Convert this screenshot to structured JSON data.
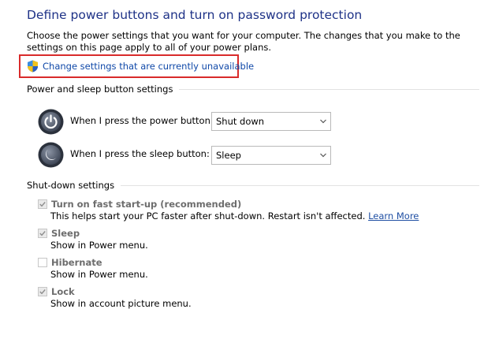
{
  "page": {
    "title": "Define power buttons and turn on password protection",
    "description": "Choose the power settings that you want for your computer. The changes that you make to the settings on this page apply to all of your power plans.",
    "change_settings_link": "Change settings that are currently unavailable",
    "highlight_color": "#d92b2b",
    "link_color": "#0f48a8",
    "title_color": "#1e3287"
  },
  "power_sleep": {
    "heading": "Power and sleep button settings",
    "power_button": {
      "label": "When I press the power button:",
      "value": "Shut down",
      "icon": "power-button-icon"
    },
    "sleep_button": {
      "label": "When I press the sleep button:",
      "value": "Sleep",
      "icon": "sleep-button-icon"
    }
  },
  "shutdown": {
    "heading": "Shut-down settings",
    "options": [
      {
        "name": "Turn on fast start-up (recommended)",
        "checked": true,
        "desc": "This helps start your PC faster after shut-down. Restart isn't affected.",
        "link": "Learn More"
      },
      {
        "name": "Sleep",
        "checked": true,
        "desc": "Show in Power menu."
      },
      {
        "name": "Hibernate",
        "checked": false,
        "desc": "Show in Power menu."
      },
      {
        "name": "Lock",
        "checked": true,
        "desc": "Show in account picture menu."
      }
    ]
  }
}
